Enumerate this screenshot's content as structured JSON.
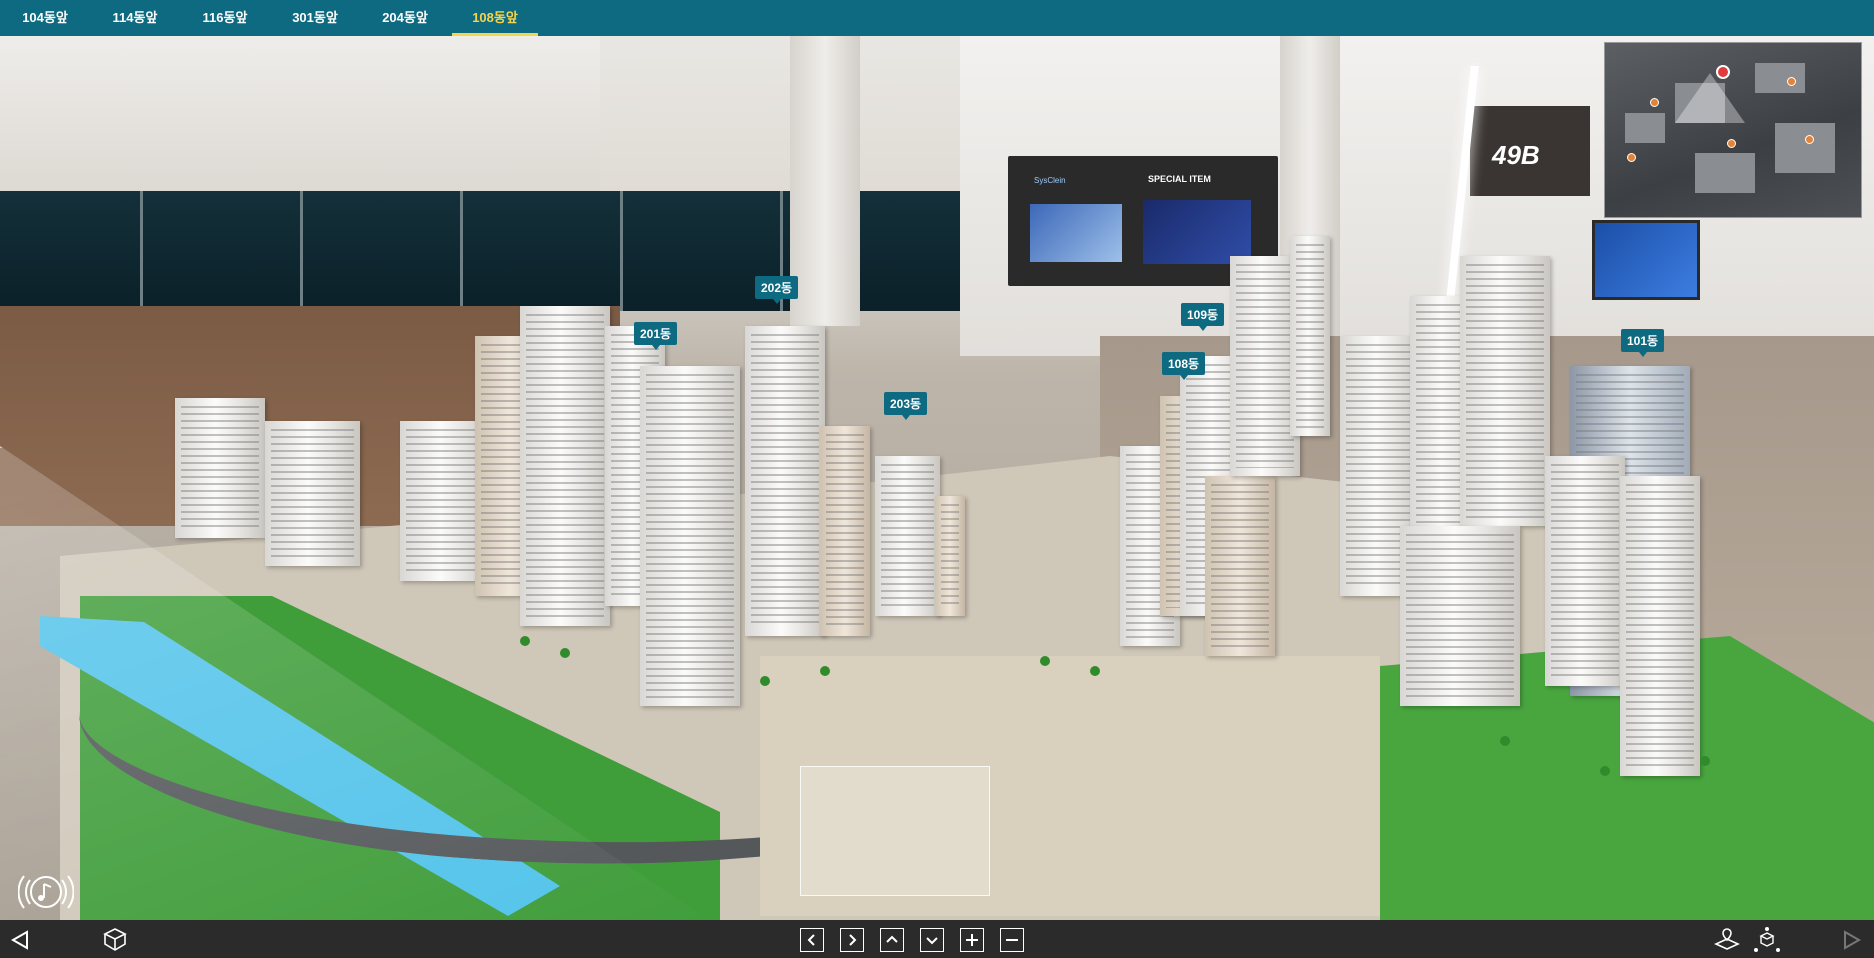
{
  "tabs": [
    {
      "label": "104동앞",
      "active": false
    },
    {
      "label": "114동앞",
      "active": false
    },
    {
      "label": "116동앞",
      "active": false
    },
    {
      "label": "301동앞",
      "active": false
    },
    {
      "label": "204동앞",
      "active": false
    },
    {
      "label": "108동앞",
      "active": true
    }
  ],
  "colors": {
    "accent": "#0e6a80",
    "active_tab": "#f6d54a"
  },
  "building_labels": {
    "b202": "202동",
    "b201": "201동",
    "b203": "203동",
    "b109": "109동",
    "b108": "108동",
    "b101": "101동"
  },
  "scene": {
    "wall_sign": "49B",
    "tv_title": "SPECIAL ITEM",
    "tv_brand": "SysClein"
  },
  "icons": {
    "music": "music-note-icon",
    "prev": "triangle-left-icon",
    "model": "cube-model-icon",
    "pan_left": "chevron-left-icon",
    "pan_right": "chevron-right-icon",
    "pan_up": "chevron-up-icon",
    "pan_down": "chevron-down-icon",
    "zoom_in": "plus-icon",
    "zoom_out": "minus-icon",
    "map": "map-pin-icon",
    "network": "network-cube-icon",
    "next": "triangle-right-icon"
  }
}
